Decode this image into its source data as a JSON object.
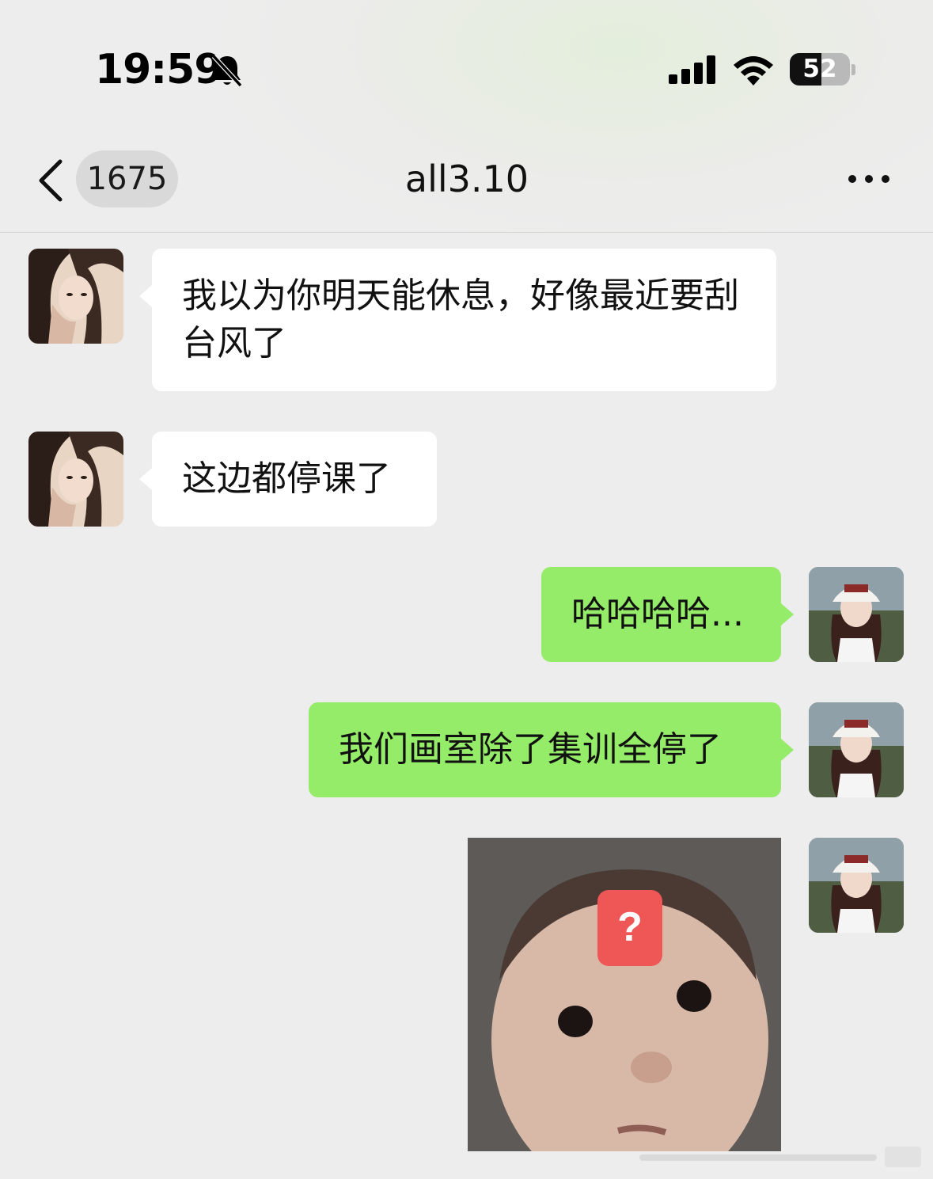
{
  "status_bar": {
    "time": "19:59",
    "battery_level": "52",
    "battery_percent": 52,
    "icons": [
      "silent-bell-icon",
      "cellular-signal-icon",
      "wifi-icon",
      "battery-icon"
    ]
  },
  "nav": {
    "back_icon": "chevron-left-icon",
    "unread_count": "1675",
    "title": "all3.10",
    "more_icon": "ellipsis-icon"
  },
  "colors": {
    "background": "#ededed",
    "incoming_bubble": "#ffffff",
    "outgoing_bubble": "#95ec69",
    "badge": "#d9d9d9"
  },
  "messages": [
    {
      "sender": "other",
      "type": "text",
      "text": "我以为你明天能休息，好像最近要刮台风了"
    },
    {
      "sender": "other",
      "type": "text",
      "text": "这边都停课了"
    },
    {
      "sender": "me",
      "type": "text",
      "text": "哈哈哈哈..."
    },
    {
      "sender": "me",
      "type": "text",
      "text": "我们画室除了集训全停了"
    },
    {
      "sender": "me",
      "type": "sticker",
      "text": "?"
    }
  ]
}
